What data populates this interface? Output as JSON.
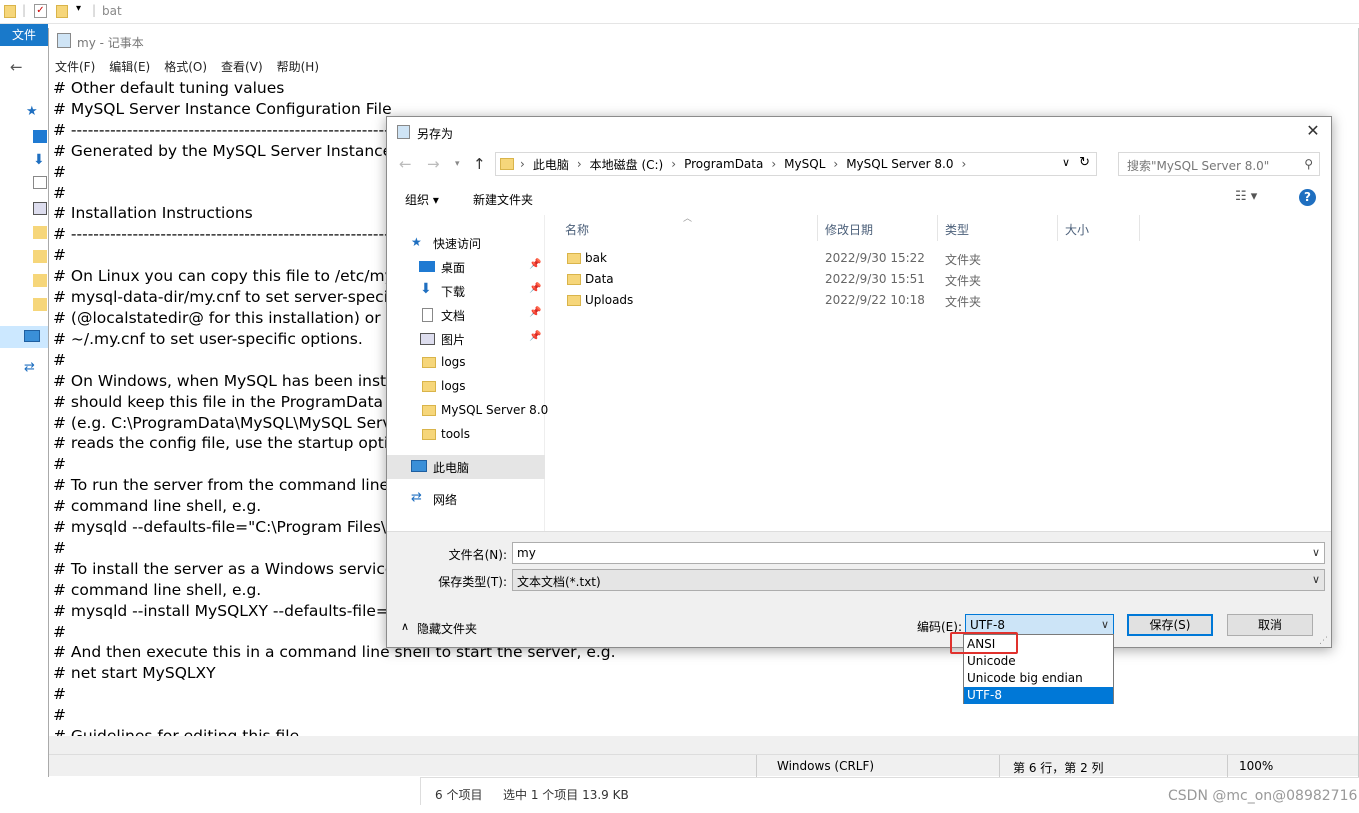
{
  "explorer": {
    "title": "bat",
    "file_tab": "文件",
    "status_items": "6 个项目",
    "status_selected": "选中 1 个项目  13.9 KB"
  },
  "notepad": {
    "title": "my - 记事本",
    "menu": [
      "文件(F)",
      "编辑(E)",
      "格式(O)",
      "查看(V)",
      "帮助(H)"
    ],
    "lines": [
      "# Other default tuning values",
      "# MySQL Server Instance Configuration File",
      "# ----------------------------------------------------------------------",
      "# Generated by the MySQL Server Instance Configuration Wizard",
      "#",
      "#",
      "# Installation Instructions",
      "# ----------------------------------------------------------------------",
      "#",
      "# On Linux you can copy this file to /etc/my.cnf to set global options,",
      "# mysql-data-dir/my.cnf to set server-specific options",
      "# (@localstatedir@ for this installation) or to",
      "# ~/.my.cnf to set user-specific options.",
      "#",
      "# On Windows, when MySQL has been installed using MySQL Installer you",
      "# should keep this file in the ProgramData directory of your server",
      "# (e.g. C:\\ProgramData\\MySQL\\MySQL Server X.Y). To make sure the server",
      "# reads the config file, use the startup option \"--defaults-file\".",
      "#",
      "# To run the server from the command line, execute this in a",
      "# command line shell, e.g.",
      "# mysqld --defaults-file=\"C:\\Program Files\\MySQL\\MySQL Server X.Y\\my.ini\"",
      "#",
      "# To install the server as a Windows service manually, execute this in a",
      "# command line shell, e.g.",
      "# mysqld --install MySQLXY --defaults-file=\"C:\\Program Files\\MySQL\\MySQL Server X.Y\\my.ini\"",
      "#",
      "# And then execute this in a command line shell to start the server, e.g.",
      "# net start MySQLXY",
      "#",
      "#",
      "# Guidelines for editing this file"
    ],
    "status_eol": "Windows (CRLF)",
    "status_pos": "第 6 行，第 2 列",
    "status_zoom": "100%"
  },
  "dialog": {
    "title": "另存为",
    "address": [
      "此电脑",
      "本地磁盘 (C:)",
      "ProgramData",
      "MySQL",
      "MySQL Server 8.0"
    ],
    "search_placeholder": "搜索\"MySQL Server 8.0\"",
    "organize": "组织 ▾",
    "new_folder": "新建文件夹",
    "nav": {
      "quick_access": "快速访问",
      "items": [
        "桌面",
        "下载",
        "文档",
        "图片",
        "logs",
        "logs",
        "MySQL Server 8.0",
        "tools"
      ],
      "this_pc": "此电脑",
      "network": "网络"
    },
    "columns": [
      "名称",
      "修改日期",
      "类型",
      "大小"
    ],
    "files": [
      {
        "name": "bak",
        "date": "2022/9/30 15:22",
        "type": "文件夹"
      },
      {
        "name": "Data",
        "date": "2022/9/30 15:51",
        "type": "文件夹"
      },
      {
        "name": "Uploads",
        "date": "2022/9/22 10:18",
        "type": "文件夹"
      }
    ],
    "filename_label": "文件名(N):",
    "filename_value": "my",
    "filetype_label": "保存类型(T):",
    "filetype_value": "文本文档(*.txt)",
    "hide_folders": "隐藏文件夹",
    "encoding_label": "编码(E):",
    "encoding_value": "UTF-8",
    "save_label": "保存(S)",
    "cancel_label": "取消",
    "encoding_options": [
      "ANSI",
      "Unicode",
      "Unicode big endian",
      "UTF-8"
    ],
    "encoding_selected": "UTF-8"
  },
  "watermark": "CSDN @mc_on@08982716",
  "colors": {
    "accent": "#0078d7",
    "highlight_box": "#e0312d",
    "folder": "#f6d67a"
  }
}
